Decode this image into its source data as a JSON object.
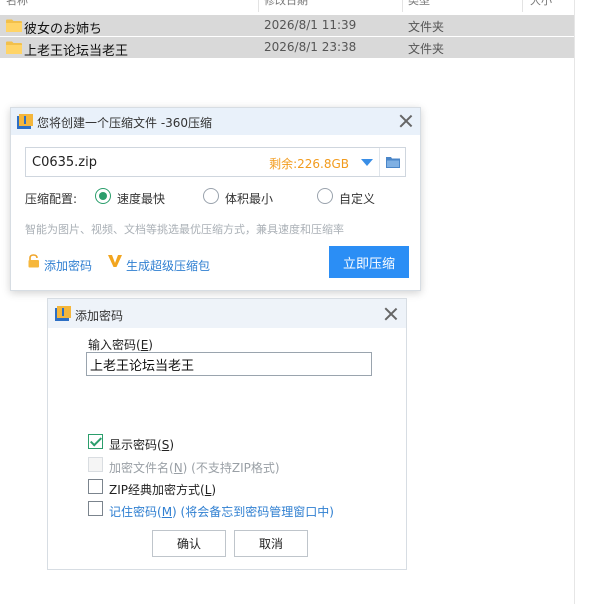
{
  "explorer": {
    "headers": {
      "name": "名称",
      "date": "修改日期",
      "type": "类型",
      "size": "大小"
    },
    "rows": [
      {
        "name": "彼女のお姉ち",
        "date": "2026/8/1 11:39",
        "type": "文件夹"
      },
      {
        "name": "上老王论坛当老王",
        "date": "2026/8/1 23:38",
        "type": "文件夹"
      }
    ]
  },
  "compress_dialog": {
    "title": "您将创建一个压缩文件 -360压缩",
    "path_value": "C0635.zip",
    "free_space": "剩余:226.8GB",
    "config_label": "压缩配置:",
    "options": [
      {
        "label": "速度最快",
        "checked": true
      },
      {
        "label": "体积最小",
        "checked": false
      },
      {
        "label": "自定义",
        "checked": false
      }
    ],
    "hint": "智能为图片、视频、文档等挑选最优压缩方式，兼具速度和压缩率",
    "add_password": "添加密码",
    "super_pack": "生成超级压缩包",
    "compress_now": "立即压缩"
  },
  "password_dialog": {
    "title": "添加密码",
    "input_label": "输入密码(",
    "input_label_key": "E",
    "input_label_end": ")",
    "input_value": "上老王论坛当老王",
    "show_password": {
      "text": "显示密码(",
      "key": "S",
      "end": ")",
      "checked": true
    },
    "encrypt_names": {
      "text": "加密文件名(",
      "key": "N",
      "end": ") (不支持ZIP格式)",
      "checked": false
    },
    "zip_classic": {
      "text": "ZIP经典加密方式(",
      "key": "L",
      "end": ")",
      "checked": false
    },
    "remember": {
      "text": "记住密码(",
      "key": "M",
      "end": ") (将会备忘到密码管理窗口中)",
      "checked": false
    },
    "ok": "确认",
    "cancel": "取消"
  },
  "colors": {
    "accent": "#2b8ef5",
    "link": "#2f7fd1",
    "check": "#2b9e6c",
    "free_space": "#f29b1d"
  }
}
